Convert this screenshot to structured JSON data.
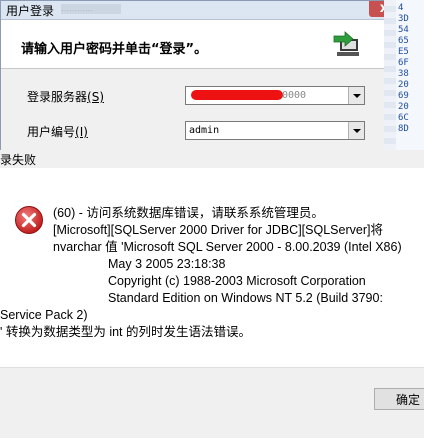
{
  "login_window": {
    "title": "用户登录",
    "title_blur": "…………",
    "close_glyph": "x",
    "prompt": "请输入用户密码并单击“登录”。",
    "server_label": "登录服务器",
    "server_hotkey": "(S)",
    "server_value_suffix": "0000",
    "user_label": "用户编号",
    "user_hotkey": "(I)",
    "user_value": "admin",
    "icon": "login-arrow-icon",
    "redaction_color": "#e11111"
  },
  "hex_strip": {
    "values": [
      "4",
      "3D",
      "54",
      "65",
      "E5",
      "6F",
      "38",
      "20",
      "69",
      "20",
      "6C",
      "8D"
    ]
  },
  "error_dialog": {
    "title": "录失败",
    "icon": "error-icon",
    "icon_color": "#d92c2c",
    "message_lines": [
      "(60) - 访问系统数据库错误，请联系系统管理员。",
      "[Microsoft][SQLServer 2000 Driver for JDBC][SQLServer]将",
      "nvarchar 值 'Microsoft SQL Server  2000 - 8.00.2039 (Intel X86)",
      "May  3 2005 23:18:38",
      "Copyright (c) 1988-2003 Microsoft Corporation",
      "Standard Edition on Windows NT 5.2 (Build 3790:",
      "Service Pack 2)",
      "' 转换为数据类型为 int 的列时发生语法错误。"
    ],
    "ok_label": "确定"
  }
}
